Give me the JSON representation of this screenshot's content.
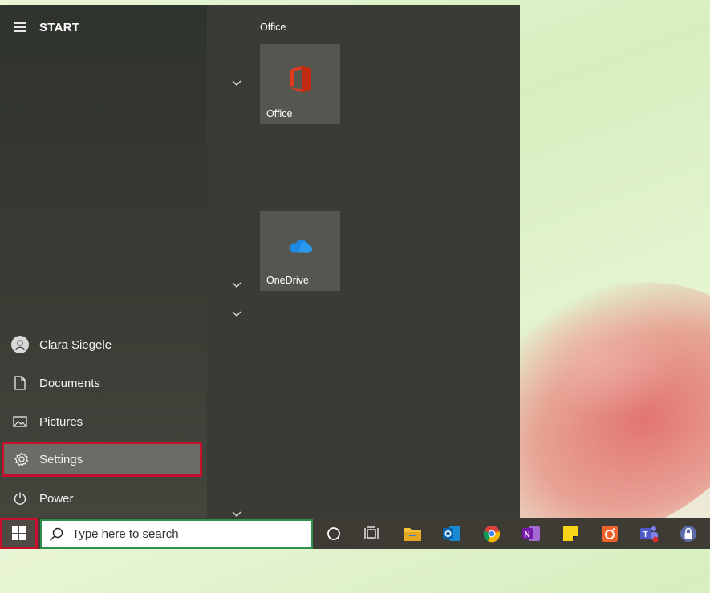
{
  "start_menu": {
    "title": "START",
    "user": {
      "name": "Clara Siegele"
    },
    "items": [
      {
        "label": "Documents",
        "icon": "document-icon"
      },
      {
        "label": "Pictures",
        "icon": "picture-icon"
      },
      {
        "label": "Settings",
        "icon": "gear-icon",
        "highlighted": true
      },
      {
        "label": "Power",
        "icon": "power-icon"
      }
    ],
    "tile_groups": [
      {
        "title": "Office",
        "tiles": [
          {
            "label": "Office",
            "icon": "office-icon"
          }
        ]
      },
      {
        "title": "",
        "tiles": [
          {
            "label": "OneDrive",
            "icon": "onedrive-icon"
          }
        ]
      }
    ]
  },
  "taskbar": {
    "search": {
      "placeholder": "Type here to search"
    },
    "pinned": [
      "cortana-icon",
      "task-view-icon",
      "file-explorer-icon",
      "outlook-icon",
      "chrome-icon",
      "onenote-icon",
      "sticky-notes-icon",
      "camera-app-icon",
      "teams-icon",
      "vpn-lock-icon"
    ]
  },
  "colors": {
    "highlight_border": "#c8102e",
    "search_border": "#2f8f4f"
  }
}
